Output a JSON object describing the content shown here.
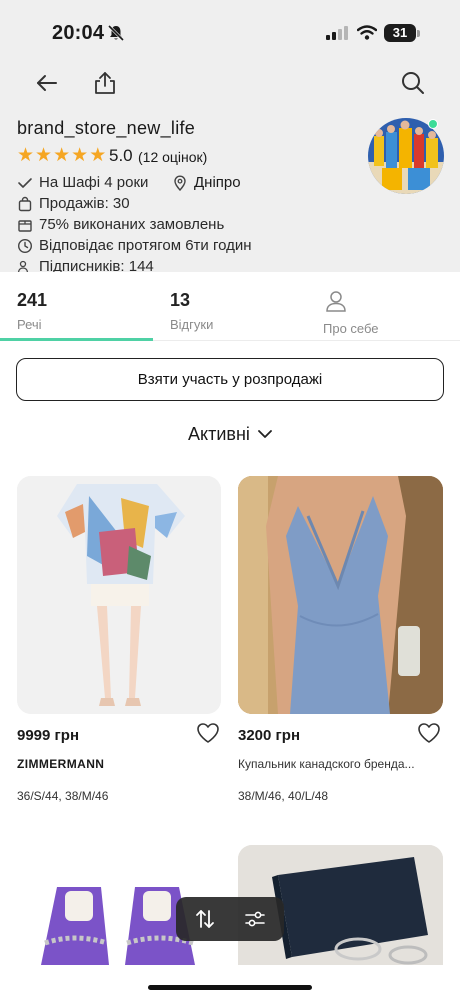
{
  "status_bar": {
    "time": "20:04",
    "battery": "31"
  },
  "nav": {
    "back_icon": "arrow-left-icon",
    "share_icon": "share-icon",
    "search_icon": "search-icon"
  },
  "profile": {
    "name": "brand_store_new_life",
    "rating_value": "5.0",
    "rating_count": "(12 оцінок)",
    "stars": 5,
    "info": {
      "on_shafa": "На Шафі 4 роки",
      "city": "Дніпро",
      "sales": "Продажів: 30",
      "orders": "75% виконаних замовлень",
      "response": "Відповідає протягом 6ти годин",
      "followers": "Підписників: 144"
    },
    "online_color": "#3ddc97"
  },
  "tabs": [
    {
      "count": "241",
      "label": "Речі",
      "active": true
    },
    {
      "count": "13",
      "label": "Відгуки",
      "active": false
    },
    {
      "label": "Про себе",
      "active": false
    }
  ],
  "sale_button": {
    "label": "Взяти участь у розпродажі"
  },
  "filter": {
    "selected": "Активні"
  },
  "products": [
    {
      "price": "9999 грн",
      "brand": "ZIMMERMANN",
      "sizes": "36/S/44, 38/M/46"
    },
    {
      "price": "3200 грн",
      "description": "Купальник канадского бренда...",
      "sizes": "38/M/46, 40/L/48"
    }
  ],
  "colors": {
    "accent": "#4fd1a5",
    "star": "#f5a623",
    "header_bg": "#efefef"
  }
}
